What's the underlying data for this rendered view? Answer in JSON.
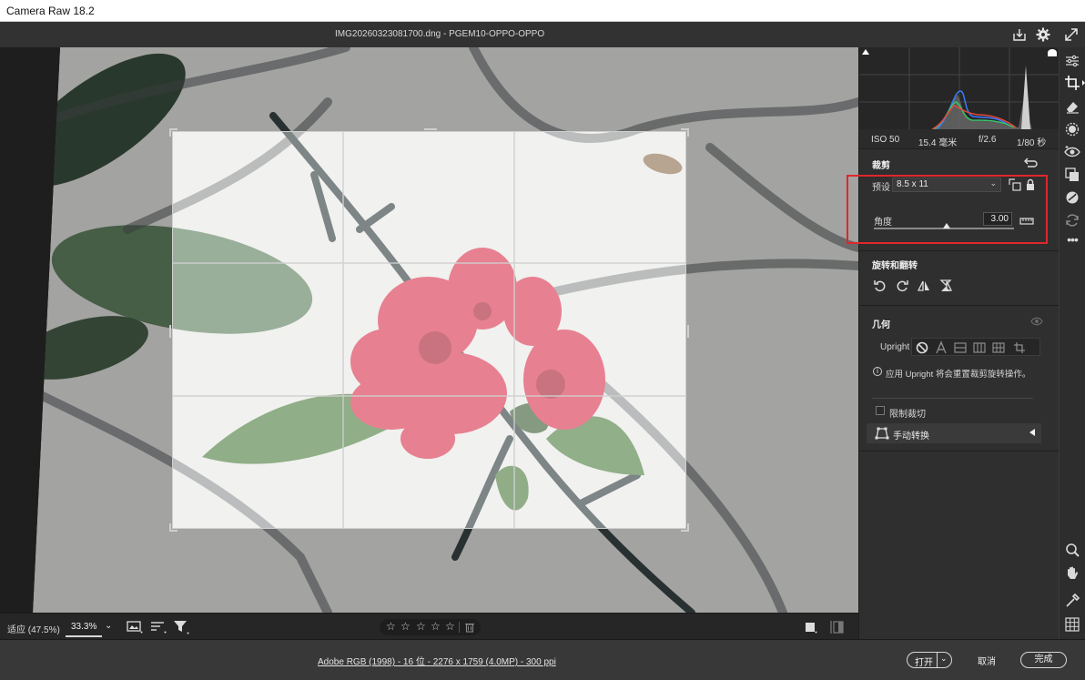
{
  "app": {
    "title": "Camera Raw 18.2"
  },
  "header": {
    "filename": "IMG20260323081700.dng  -  PGEM10-OPPO-OPPO"
  },
  "exif": {
    "iso": "ISO 50",
    "focal": "15.4 毫米",
    "aperture": "f/2.6",
    "shutter": "1/80 秒"
  },
  "crop": {
    "title": "裁剪",
    "preset_label": "预设",
    "preset_value": "8.5 x 11",
    "angle_label": "角度",
    "angle_value": "3.00",
    "angle_slider_fraction": 0.52
  },
  "rotate": {
    "title": "旋转和翻转"
  },
  "geometry": {
    "title": "几何",
    "upright_label": "Upright",
    "info_text": "应用 Upright 将会重置裁剪旋转操作。",
    "limit_crop_label": "限制裁切",
    "manual_transform_label": "手动转换"
  },
  "bottombar": {
    "zoom_fit": "适应 (47.5%)",
    "zoom_level": "33.3%"
  },
  "rating": {
    "stars": 0,
    "max": 5
  },
  "footer": {
    "info": "Adobe RGB (1998) - 16 位 - 2276 x 1759 (4.0MP) - 300 ppi",
    "open_label": "打开",
    "cancel_label": "取消",
    "done_label": "完成"
  },
  "colors": {
    "highlight_box": "#e0262c",
    "accent": "#ffffff"
  }
}
